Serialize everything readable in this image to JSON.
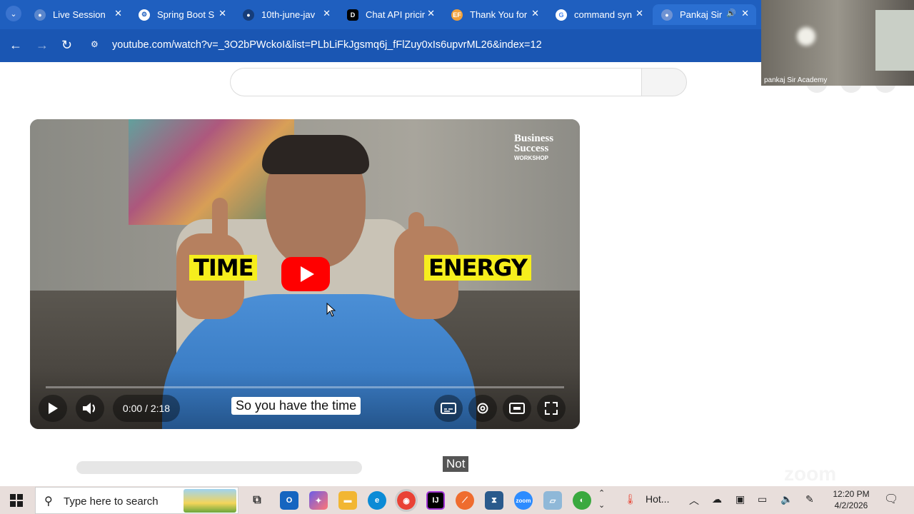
{
  "tabs": [
    {
      "title": "Live Session",
      "favicon": "globe-icon"
    },
    {
      "title": "Spring Boot S",
      "favicon": "chatgpt-icon"
    },
    {
      "title": "10th-june-jav",
      "favicon": "github-icon"
    },
    {
      "title": "Chat API pricir",
      "favicon": "app-icon"
    },
    {
      "title": "Thank You for",
      "favicon": "ef-icon"
    },
    {
      "title": "command syn",
      "favicon": "google-icon"
    },
    {
      "title": "Pankaj Sir",
      "favicon": "globe-icon",
      "active": true
    }
  ],
  "address": {
    "url": "youtube.com/watch?v=_3O2bPWckoI&list=PLbLiFkJgsmq6j_fFlZuy0xIs6upvrML26&index=12"
  },
  "video": {
    "logo_top": "Business Success",
    "logo_bottom": "WORKSHOP",
    "label_left": "TIME",
    "label_right": "ENERGY",
    "time": "0:00 / 2:18",
    "caption": "So you have the time",
    "progress": 0
  },
  "page": {
    "badge": "Not",
    "watermark": "zoom"
  },
  "camera": {
    "label": "pankaj Sir Academy"
  },
  "taskbar": {
    "search_placeholder": "Type here to search",
    "weather": "Hot...",
    "time": "12:20 PM",
    "date": "4/2/2026"
  },
  "colors": {
    "chrome": "#1f5fbf",
    "youtube_red": "#ff0000",
    "label_yellow": "#f6ee1d"
  }
}
